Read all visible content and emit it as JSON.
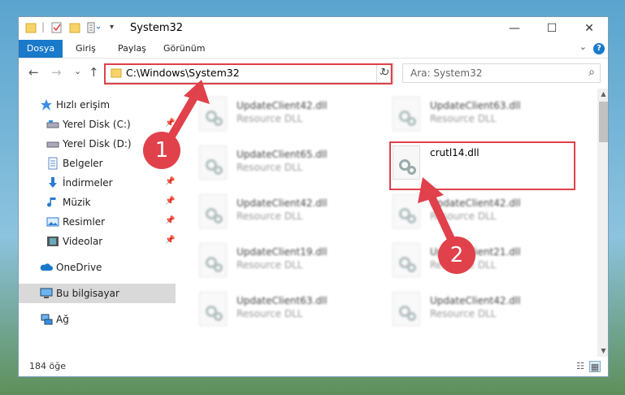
{
  "window": {
    "title": "System32",
    "controls": {
      "minimize": "—",
      "maximize": "☐",
      "close": "✕"
    }
  },
  "ribbon": {
    "tabs": [
      "Dosya",
      "Giriş",
      "Paylaş",
      "Görünüm"
    ],
    "help": "?"
  },
  "nav": {
    "back": "←",
    "forward": "→",
    "recent": "⌄",
    "up": "↑",
    "address": "C:\\Windows\\System32",
    "search_placeholder": "Ara: System32"
  },
  "sidebar": {
    "items": [
      {
        "label": "Hızlı erişim",
        "icon": "star-icon"
      },
      {
        "label": "Yerel Disk (C:)",
        "icon": "drive-icon"
      },
      {
        "label": "Yerel Disk (D:)",
        "icon": "drive-icon"
      },
      {
        "label": "Belgeler",
        "icon": "documents-icon"
      },
      {
        "label": "İndirmeler",
        "icon": "download-icon"
      },
      {
        "label": "Müzik",
        "icon": "music-icon"
      },
      {
        "label": "Resimler",
        "icon": "pictures-icon"
      },
      {
        "label": "Videolar",
        "icon": "videos-icon"
      },
      {
        "label": "OneDrive",
        "icon": "cloud-icon"
      },
      {
        "label": "Bu bilgisayar",
        "icon": "computer-icon"
      },
      {
        "label": "Ağ",
        "icon": "network-icon"
      }
    ]
  },
  "files": [
    {
      "name": "UpdateClient42.dll",
      "desc": "Resource DLL"
    },
    {
      "name": "UpdateClient63.dll",
      "desc": "Resource DLL"
    },
    {
      "name": "UpdateClient65.dll",
      "desc": "Resource DLL"
    },
    {
      "name": "crutl14.dll",
      "desc": ""
    },
    {
      "name": "UpdateClient42.dll",
      "desc": "Resource DLL"
    },
    {
      "name": "UpdateClient42.dll",
      "desc": "Resource DLL"
    },
    {
      "name": "UpdateClient19.dll",
      "desc": "Resource DLL"
    },
    {
      "name": "UpdateClient21.dll",
      "desc": "Resource DLL"
    },
    {
      "name": "UpdateClient63.dll",
      "desc": "Resource DLL"
    },
    {
      "name": "UpdateClient42.dll",
      "desc": "Resource DLL"
    }
  ],
  "status": {
    "count": "184 öğe"
  },
  "callouts": {
    "one": "1",
    "two": "2"
  },
  "colors": {
    "accent": "#1979ca",
    "highlight": "#e0414b"
  }
}
